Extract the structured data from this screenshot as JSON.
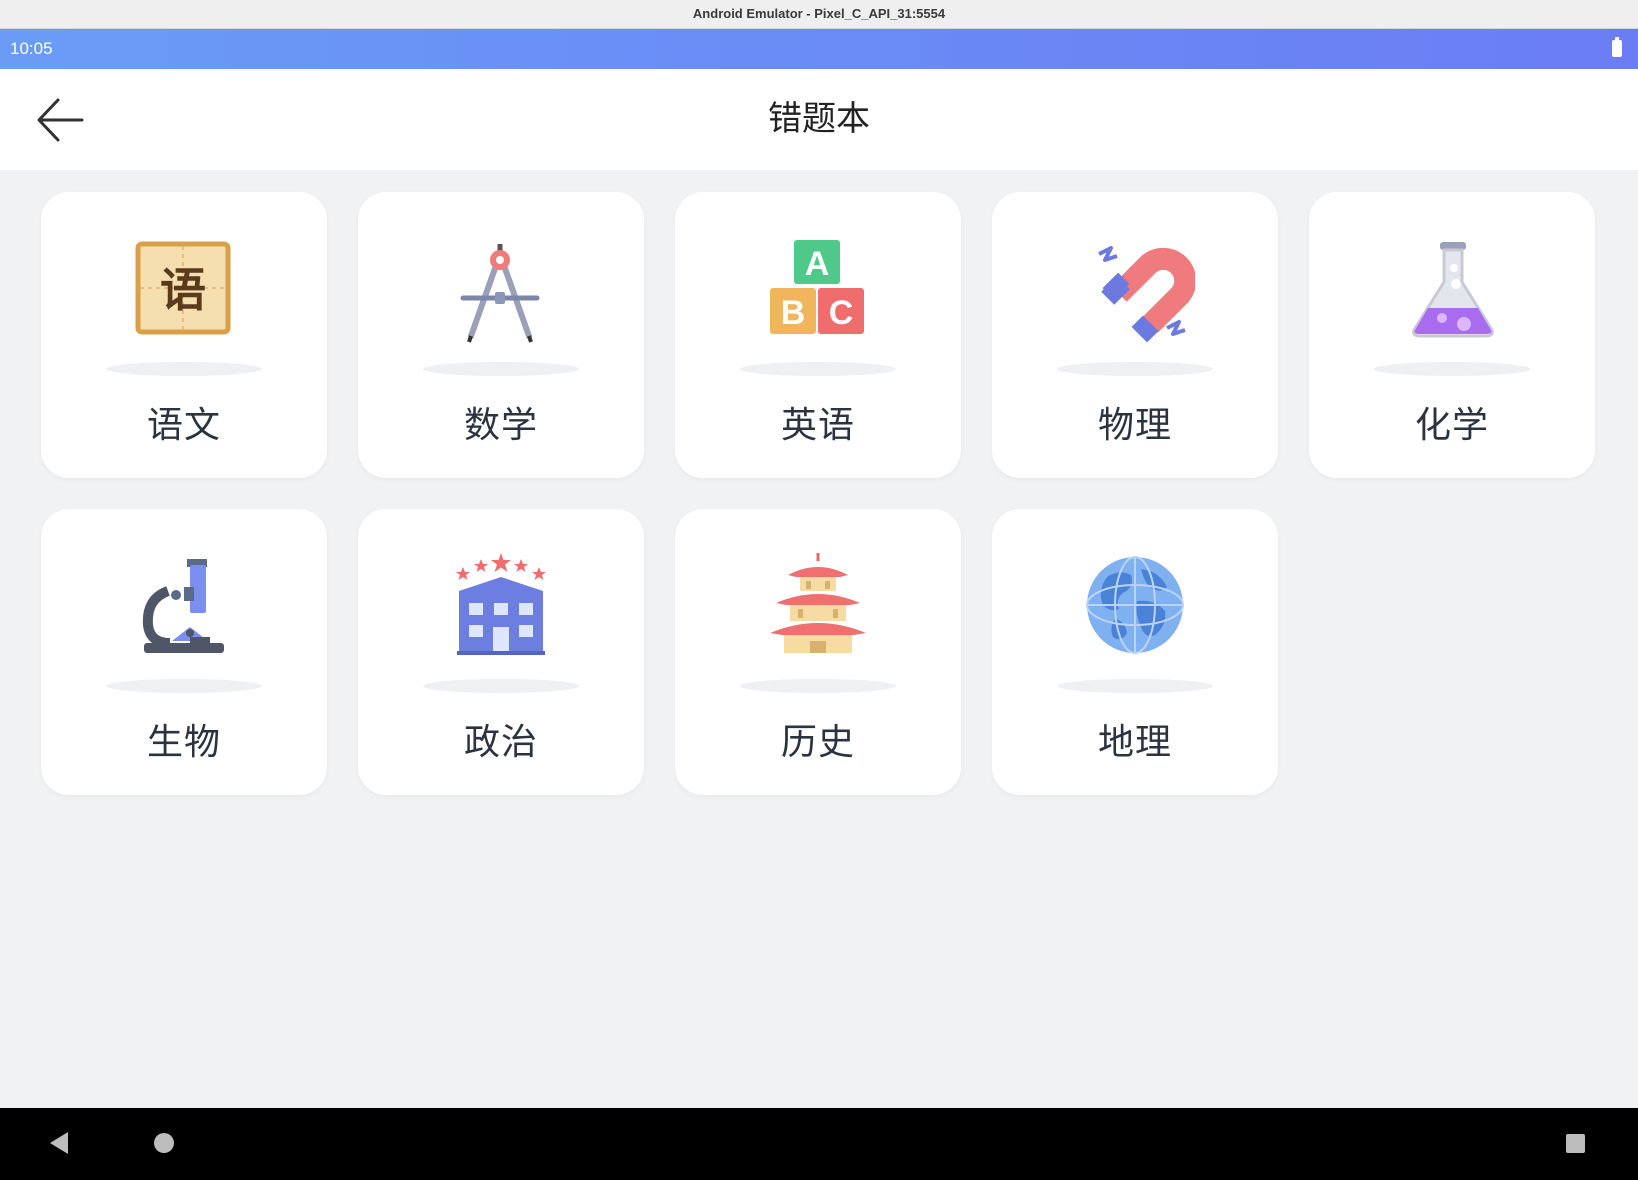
{
  "window": {
    "title": "Android Emulator - Pixel_C_API_31:5554"
  },
  "status_bar": {
    "time": "10:05",
    "battery_icon": "battery-icon"
  },
  "header": {
    "title": "错题本",
    "back_icon": "arrow-left-icon"
  },
  "subjects": [
    {
      "label": "语文",
      "icon": "chinese-character-icon",
      "icon_text": "语"
    },
    {
      "label": "数学",
      "icon": "compass-drawing-icon"
    },
    {
      "label": "英语",
      "icon": "abc-blocks-icon",
      "icon_text": [
        "A",
        "B",
        "C"
      ]
    },
    {
      "label": "物理",
      "icon": "magnet-icon"
    },
    {
      "label": "化学",
      "icon": "flask-icon"
    },
    {
      "label": "生物",
      "icon": "microscope-icon"
    },
    {
      "label": "政治",
      "icon": "government-building-icon"
    },
    {
      "label": "历史",
      "icon": "pagoda-icon"
    },
    {
      "label": "地理",
      "icon": "globe-icon"
    }
  ],
  "nav_bar": {
    "back": "triangle-back-icon",
    "home": "circle-home-icon",
    "recents": "square-recents-icon"
  },
  "colors": {
    "status_bar_start": "#6a9cf6",
    "status_bar_end": "#6b7df4",
    "background": "#f1f2f4",
    "card": "#ffffff"
  }
}
